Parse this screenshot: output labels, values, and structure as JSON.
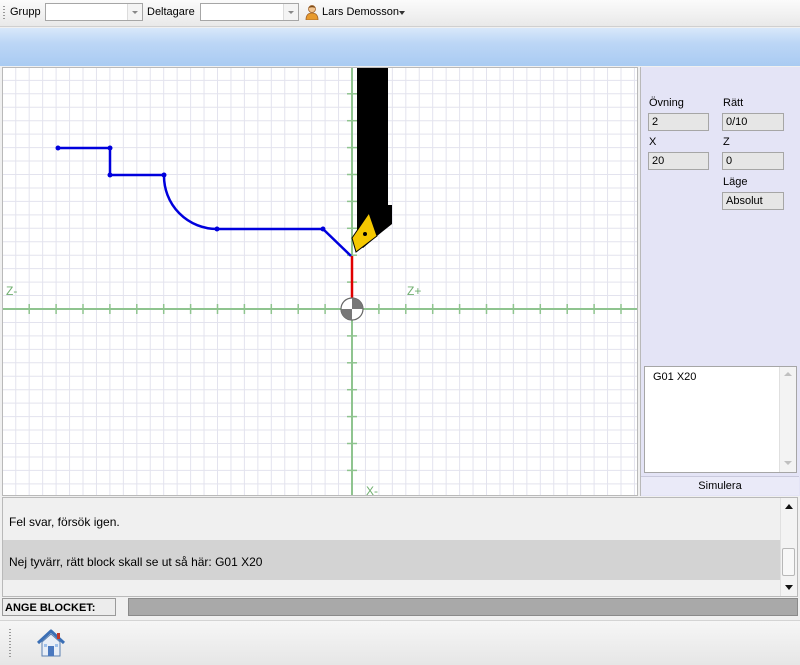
{
  "toolbar": {
    "grupp_label": "Grupp",
    "grupp_value": "",
    "deltagare_label": "Deltagare",
    "deltagare_value": "",
    "user_name": "Lars Demosson"
  },
  "canvas": {
    "axis_z_minus": "Z-",
    "axis_z_plus": "Z+",
    "axis_x_minus": "X-",
    "colors": {
      "path": "#0000dd",
      "axis": "#8fc48f",
      "grid": "#e3e3ee",
      "toolpath": "#e00000",
      "insert": "#f5c800"
    }
  },
  "panel": {
    "ovning_label": "Övning",
    "ovning_value": "2",
    "ratt_label": "Rätt",
    "ratt_value": "0/10",
    "x_label": "X",
    "x_value": "20",
    "z_label": "Z",
    "z_value": "0",
    "lage_label": "Läge",
    "lage_value": "Absolut",
    "code": "G01 X20",
    "simulera_label": "Simulera"
  },
  "messages": {
    "line1": "Fel svar, försök igen.",
    "line2": "Nej tyvärr, rätt block skall se ut så här: G01 X20"
  },
  "input": {
    "label": "ANGE BLOCKET:",
    "value": ""
  },
  "icons": {
    "user": "user-icon",
    "home": "home-icon",
    "dropdown": "chevron-down-icon"
  }
}
